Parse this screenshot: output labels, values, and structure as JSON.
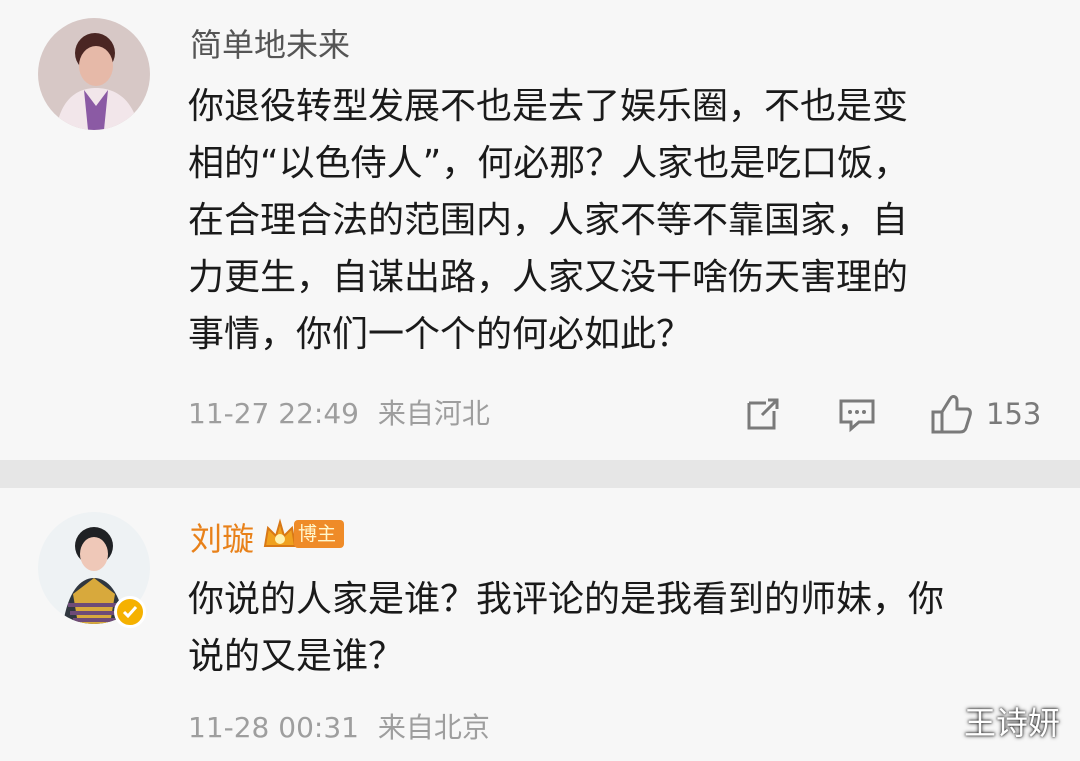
{
  "comments": [
    {
      "username": "简单地未来",
      "text": "你退役转型发展不也是去了娱乐圈，不也是变\n相的“以色侍人”，何必那？人家也是吃口饭，\n在合理合法的范围内，人家不等不靠国家，自\n力更生，自谋出路，人家又没干啥伤天害理的\n事情，你们一个个的何必如此？",
      "time": "11-27 22:49",
      "location": "来自河北",
      "like_count": "153",
      "icons": [
        "share-icon",
        "comment-icon",
        "like-icon"
      ]
    },
    {
      "username": "刘璇",
      "badge": "博主",
      "text": "你说的人家是谁？我评论的是我看到的师妹，你\n说的又是谁？",
      "time": "11-28 00:31",
      "location": "来自北京"
    }
  ],
  "watermark": "王诗妍",
  "colors": {
    "background": "#f7f7f7",
    "separator": "#e6e6e6",
    "username_orange": "#e8811a",
    "verified_gold": "#f5b100"
  }
}
